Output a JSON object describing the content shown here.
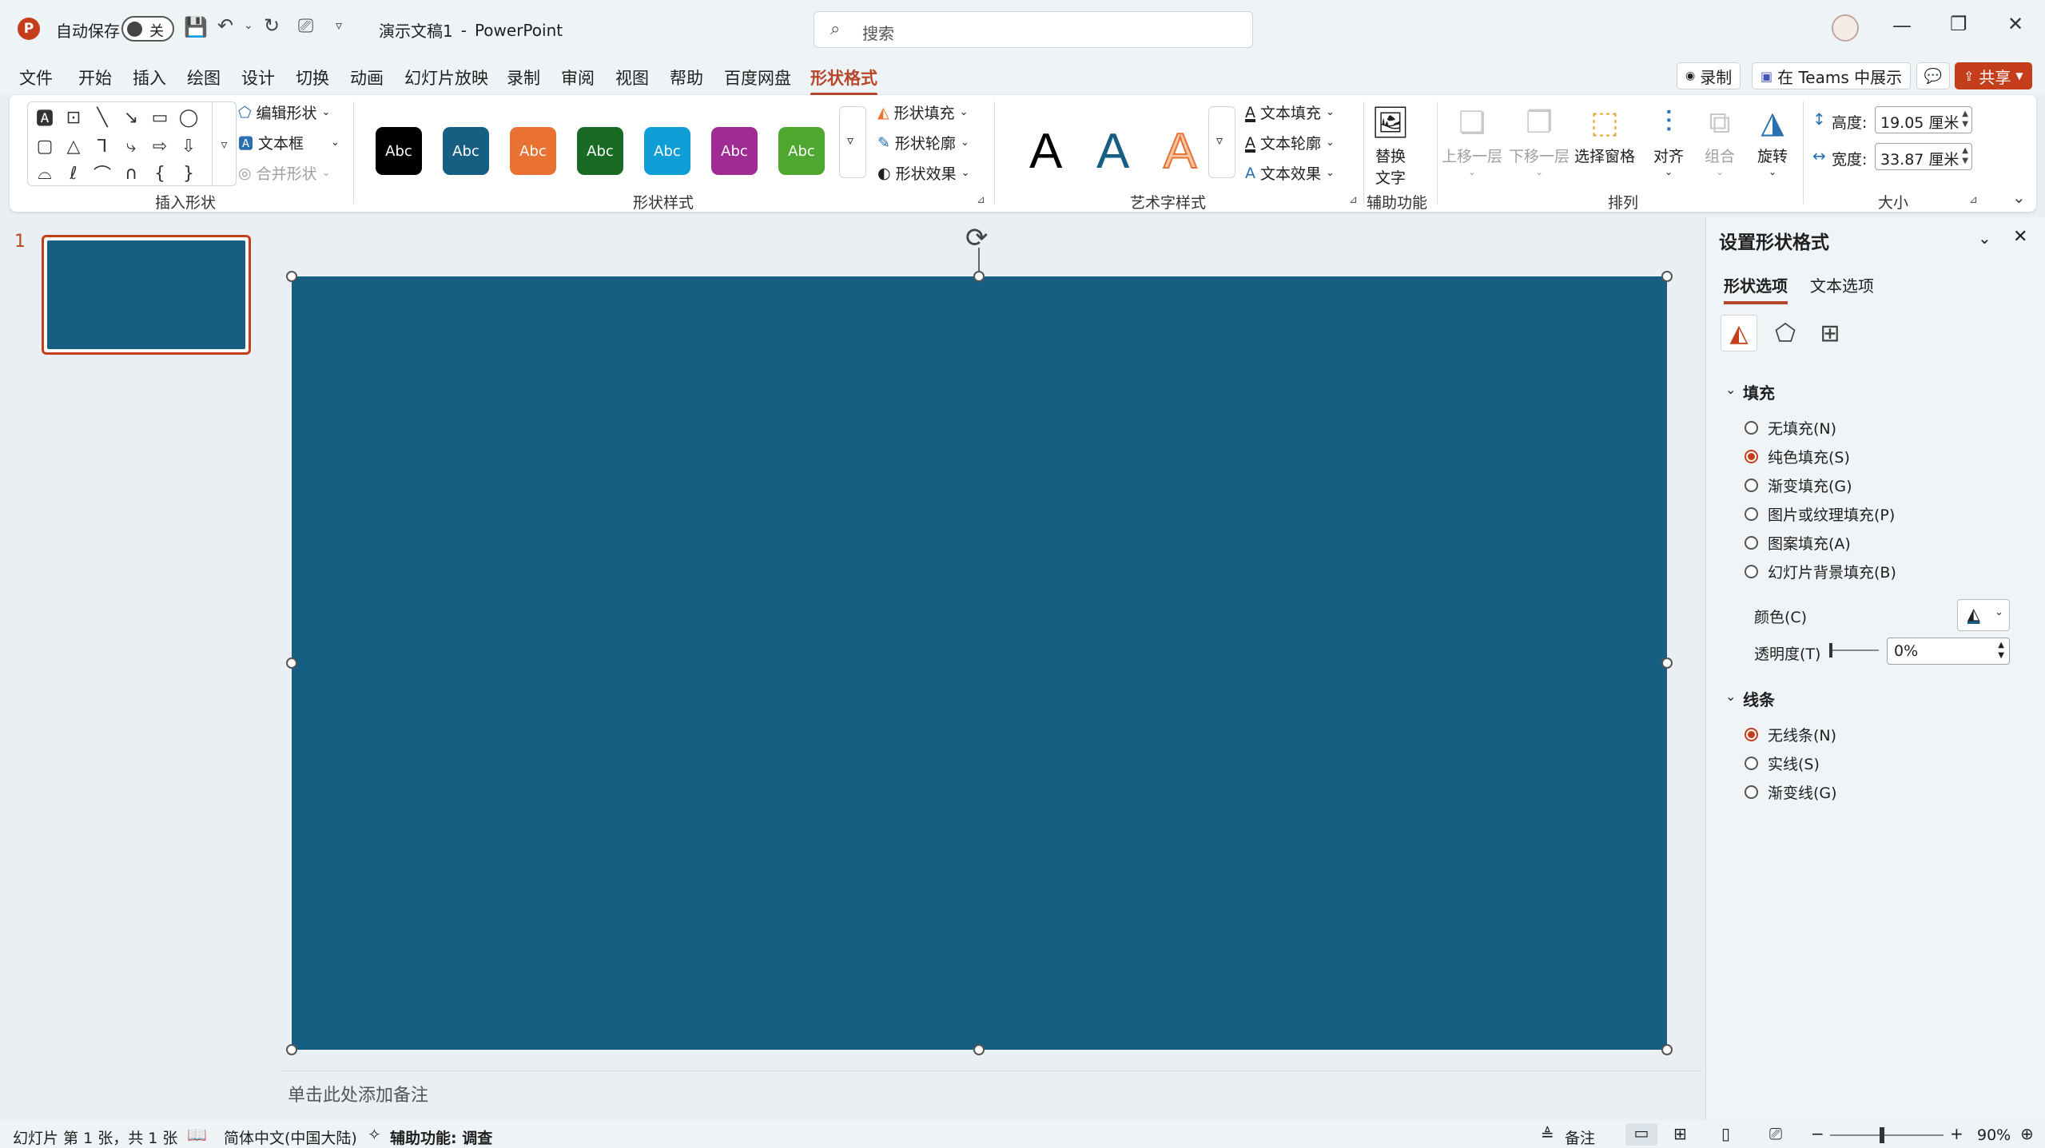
{
  "titlebar": {
    "app_icon": "P",
    "autosave_label": "自动保存",
    "autosave_state": "关",
    "doc_name": "演示文稿1",
    "separator": "-",
    "app_name": "PowerPoint",
    "search_placeholder": "搜索",
    "icons": [
      "save-icon",
      "undo-icon",
      "redo-icon",
      "present-icon",
      "customize-icon",
      "avatar",
      "minimize-icon",
      "maximize-icon",
      "close-icon"
    ]
  },
  "menu": {
    "tabs": [
      "文件",
      "开始",
      "插入",
      "绘图",
      "设计",
      "切换",
      "动画",
      "幻灯片放映",
      "录制",
      "审阅",
      "视图",
      "帮助",
      "百度网盘",
      "形状格式"
    ],
    "active_tab": "形状格式",
    "record_label": "录制",
    "teams_label": "在 Teams 中展示",
    "share_label": "共享"
  },
  "ribbon": {
    "insert_shapes": {
      "label": "插入形状",
      "edit_shape": "编辑形状",
      "text_box": "文本框",
      "merge_shapes": "合并形状"
    },
    "shape_styles": {
      "label": "形状样式",
      "swatch_text": "Abc",
      "swatch_colors": [
        "#000000",
        "#175f82",
        "#e97132",
        "#196b24",
        "#0f9ed5",
        "#a02b93",
        "#4ea72e"
      ],
      "fill": "形状填充",
      "outline": "形状轮廓",
      "effects": "形状效果"
    },
    "wordart": {
      "label": "艺术字样式",
      "letter": "A",
      "text_fill": "文本填充",
      "text_outline": "文本轮廓",
      "text_effects": "文本效果"
    },
    "accessibility": {
      "label": "辅助功能",
      "alt_text_line1": "替换",
      "alt_text_line2": "文字"
    },
    "arrange": {
      "label": "排列",
      "bring_forward": "上移一层",
      "send_backward": "下移一层",
      "selection_pane": "选择窗格",
      "align": "对齐",
      "group": "组合",
      "rotate": "旋转"
    },
    "size": {
      "label": "大小",
      "height_label": "高度:",
      "height_value": "19.05 厘米",
      "width_label": "宽度:",
      "width_value": "33.87 厘米"
    }
  },
  "slides": {
    "number": "1",
    "slide_color": "#175f82"
  },
  "canvas": {
    "shape_color": "#175f82",
    "notes_placeholder": "单击此处添加备注"
  },
  "pane": {
    "title": "设置形状格式",
    "tab_shape": "形状选项",
    "tab_text": "文本选项",
    "fill_header": "填充",
    "fill_options": [
      "无填充(N)",
      "纯色填充(S)",
      "渐变填充(G)",
      "图片或纹理填充(P)",
      "图案填充(A)",
      "幻灯片背景填充(B)"
    ],
    "fill_selected": 1,
    "color_label": "颜色(C)",
    "transparency_label": "透明度(T)",
    "transparency_value": "0%",
    "line_header": "线条",
    "line_options": [
      "无线条(N)",
      "实线(S)",
      "渐变线(G)"
    ],
    "line_selected": 0
  },
  "statusbar": {
    "slide_info": "幻灯片 第 1 张，共 1 张",
    "language": "简体中文(中国大陆)",
    "accessibility": "辅助功能: 调查",
    "notes": "备注",
    "zoom": "90%"
  }
}
